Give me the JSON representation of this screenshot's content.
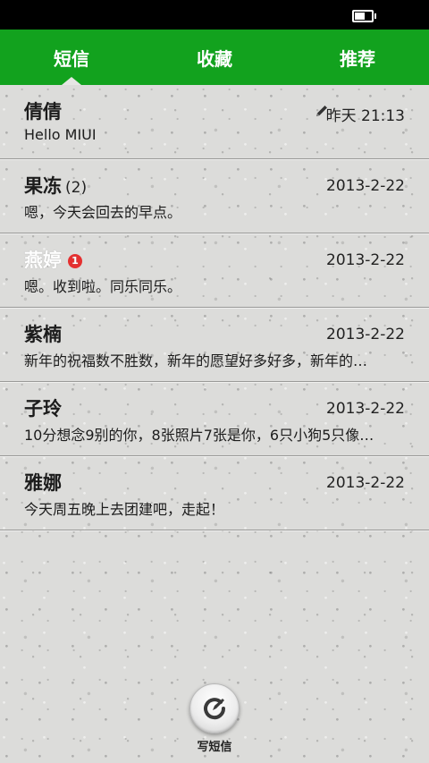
{
  "status_bar": {
    "battery_level_percent": 70
  },
  "tabs": [
    {
      "label": "短信",
      "active": true
    },
    {
      "label": "收藏",
      "active": false
    },
    {
      "label": "推荐",
      "active": false
    }
  ],
  "conversations": [
    {
      "name": "倩倩",
      "count": "",
      "unread": "",
      "date": "昨天 21:13",
      "preview": "Hello MIUI",
      "draft": true
    },
    {
      "name": "果冻",
      "count": "(2)",
      "unread": "",
      "date": "2013-2-22",
      "preview": "嗯，今天会回去的早点。",
      "draft": false
    },
    {
      "name": "燕婷",
      "count": "",
      "unread": "1",
      "date": "2013-2-22",
      "preview": "嗯。收到啦。同乐同乐。",
      "draft": false
    },
    {
      "name": "紫楠",
      "count": "",
      "unread": "",
      "date": "2013-2-22",
      "preview": "新年的祝福数不胜数，新年的愿望好多好多，新年的…",
      "draft": false
    },
    {
      "name": "子玲",
      "count": "",
      "unread": "",
      "date": "2013-2-22",
      "preview": "10分想念9别的你，8张照片7张是你，6只小狗5只像…",
      "draft": false
    },
    {
      "name": "雅娜",
      "count": "",
      "unread": "",
      "date": "2013-2-22",
      "preview": "今天周五晚上去团建吧，走起！",
      "draft": false
    }
  ],
  "compose": {
    "label": "写短信",
    "icon": "compose-pen-icon"
  },
  "colors": {
    "accent": "#12a21e",
    "badge": "#e53030"
  }
}
